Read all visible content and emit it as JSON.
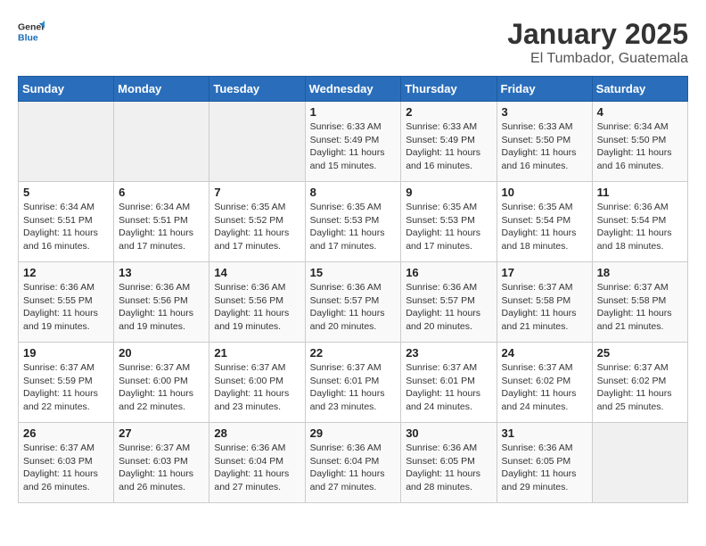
{
  "logo": {
    "general": "General",
    "blue": "Blue"
  },
  "title": "January 2025",
  "location": "El Tumbador, Guatemala",
  "weekdays": [
    "Sunday",
    "Monday",
    "Tuesday",
    "Wednesday",
    "Thursday",
    "Friday",
    "Saturday"
  ],
  "weeks": [
    [
      {
        "day": "",
        "sunrise": "",
        "sunset": "",
        "daylight": ""
      },
      {
        "day": "",
        "sunrise": "",
        "sunset": "",
        "daylight": ""
      },
      {
        "day": "",
        "sunrise": "",
        "sunset": "",
        "daylight": ""
      },
      {
        "day": "1",
        "sunrise": "Sunrise: 6:33 AM",
        "sunset": "Sunset: 5:49 PM",
        "daylight": "Daylight: 11 hours and 15 minutes."
      },
      {
        "day": "2",
        "sunrise": "Sunrise: 6:33 AM",
        "sunset": "Sunset: 5:49 PM",
        "daylight": "Daylight: 11 hours and 16 minutes."
      },
      {
        "day": "3",
        "sunrise": "Sunrise: 6:33 AM",
        "sunset": "Sunset: 5:50 PM",
        "daylight": "Daylight: 11 hours and 16 minutes."
      },
      {
        "day": "4",
        "sunrise": "Sunrise: 6:34 AM",
        "sunset": "Sunset: 5:50 PM",
        "daylight": "Daylight: 11 hours and 16 minutes."
      }
    ],
    [
      {
        "day": "5",
        "sunrise": "Sunrise: 6:34 AM",
        "sunset": "Sunset: 5:51 PM",
        "daylight": "Daylight: 11 hours and 16 minutes."
      },
      {
        "day": "6",
        "sunrise": "Sunrise: 6:34 AM",
        "sunset": "Sunset: 5:51 PM",
        "daylight": "Daylight: 11 hours and 17 minutes."
      },
      {
        "day": "7",
        "sunrise": "Sunrise: 6:35 AM",
        "sunset": "Sunset: 5:52 PM",
        "daylight": "Daylight: 11 hours and 17 minutes."
      },
      {
        "day": "8",
        "sunrise": "Sunrise: 6:35 AM",
        "sunset": "Sunset: 5:53 PM",
        "daylight": "Daylight: 11 hours and 17 minutes."
      },
      {
        "day": "9",
        "sunrise": "Sunrise: 6:35 AM",
        "sunset": "Sunset: 5:53 PM",
        "daylight": "Daylight: 11 hours and 17 minutes."
      },
      {
        "day": "10",
        "sunrise": "Sunrise: 6:35 AM",
        "sunset": "Sunset: 5:54 PM",
        "daylight": "Daylight: 11 hours and 18 minutes."
      },
      {
        "day": "11",
        "sunrise": "Sunrise: 6:36 AM",
        "sunset": "Sunset: 5:54 PM",
        "daylight": "Daylight: 11 hours and 18 minutes."
      }
    ],
    [
      {
        "day": "12",
        "sunrise": "Sunrise: 6:36 AM",
        "sunset": "Sunset: 5:55 PM",
        "daylight": "Daylight: 11 hours and 19 minutes."
      },
      {
        "day": "13",
        "sunrise": "Sunrise: 6:36 AM",
        "sunset": "Sunset: 5:56 PM",
        "daylight": "Daylight: 11 hours and 19 minutes."
      },
      {
        "day": "14",
        "sunrise": "Sunrise: 6:36 AM",
        "sunset": "Sunset: 5:56 PM",
        "daylight": "Daylight: 11 hours and 19 minutes."
      },
      {
        "day": "15",
        "sunrise": "Sunrise: 6:36 AM",
        "sunset": "Sunset: 5:57 PM",
        "daylight": "Daylight: 11 hours and 20 minutes."
      },
      {
        "day": "16",
        "sunrise": "Sunrise: 6:36 AM",
        "sunset": "Sunset: 5:57 PM",
        "daylight": "Daylight: 11 hours and 20 minutes."
      },
      {
        "day": "17",
        "sunrise": "Sunrise: 6:37 AM",
        "sunset": "Sunset: 5:58 PM",
        "daylight": "Daylight: 11 hours and 21 minutes."
      },
      {
        "day": "18",
        "sunrise": "Sunrise: 6:37 AM",
        "sunset": "Sunset: 5:58 PM",
        "daylight": "Daylight: 11 hours and 21 minutes."
      }
    ],
    [
      {
        "day": "19",
        "sunrise": "Sunrise: 6:37 AM",
        "sunset": "Sunset: 5:59 PM",
        "daylight": "Daylight: 11 hours and 22 minutes."
      },
      {
        "day": "20",
        "sunrise": "Sunrise: 6:37 AM",
        "sunset": "Sunset: 6:00 PM",
        "daylight": "Daylight: 11 hours and 22 minutes."
      },
      {
        "day": "21",
        "sunrise": "Sunrise: 6:37 AM",
        "sunset": "Sunset: 6:00 PM",
        "daylight": "Daylight: 11 hours and 23 minutes."
      },
      {
        "day": "22",
        "sunrise": "Sunrise: 6:37 AM",
        "sunset": "Sunset: 6:01 PM",
        "daylight": "Daylight: 11 hours and 23 minutes."
      },
      {
        "day": "23",
        "sunrise": "Sunrise: 6:37 AM",
        "sunset": "Sunset: 6:01 PM",
        "daylight": "Daylight: 11 hours and 24 minutes."
      },
      {
        "day": "24",
        "sunrise": "Sunrise: 6:37 AM",
        "sunset": "Sunset: 6:02 PM",
        "daylight": "Daylight: 11 hours and 24 minutes."
      },
      {
        "day": "25",
        "sunrise": "Sunrise: 6:37 AM",
        "sunset": "Sunset: 6:02 PM",
        "daylight": "Daylight: 11 hours and 25 minutes."
      }
    ],
    [
      {
        "day": "26",
        "sunrise": "Sunrise: 6:37 AM",
        "sunset": "Sunset: 6:03 PM",
        "daylight": "Daylight: 11 hours and 26 minutes."
      },
      {
        "day": "27",
        "sunrise": "Sunrise: 6:37 AM",
        "sunset": "Sunset: 6:03 PM",
        "daylight": "Daylight: 11 hours and 26 minutes."
      },
      {
        "day": "28",
        "sunrise": "Sunrise: 6:36 AM",
        "sunset": "Sunset: 6:04 PM",
        "daylight": "Daylight: 11 hours and 27 minutes."
      },
      {
        "day": "29",
        "sunrise": "Sunrise: 6:36 AM",
        "sunset": "Sunset: 6:04 PM",
        "daylight": "Daylight: 11 hours and 27 minutes."
      },
      {
        "day": "30",
        "sunrise": "Sunrise: 6:36 AM",
        "sunset": "Sunset: 6:05 PM",
        "daylight": "Daylight: 11 hours and 28 minutes."
      },
      {
        "day": "31",
        "sunrise": "Sunrise: 6:36 AM",
        "sunset": "Sunset: 6:05 PM",
        "daylight": "Daylight: 11 hours and 29 minutes."
      },
      {
        "day": "",
        "sunrise": "",
        "sunset": "",
        "daylight": ""
      }
    ]
  ]
}
